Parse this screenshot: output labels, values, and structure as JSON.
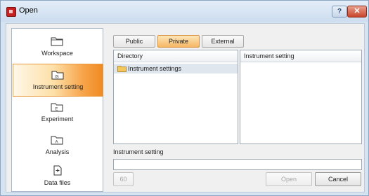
{
  "window": {
    "title": "Open",
    "help_label": "?",
    "close_label": "✕"
  },
  "sidebar": {
    "items": [
      {
        "label": "Workspace",
        "icon": "folder-icon"
      },
      {
        "label": "Instrument setting",
        "icon": "folder-is-icon",
        "selected": true
      },
      {
        "label": "Experiment",
        "icon": "folder-e-icon"
      },
      {
        "label": "Analysis",
        "icon": "folder-a-icon"
      },
      {
        "label": "Data files",
        "icon": "document-plus-icon"
      }
    ]
  },
  "tabs": [
    {
      "label": "Public"
    },
    {
      "label": "Private",
      "selected": true
    },
    {
      "label": "External"
    }
  ],
  "directory": {
    "header": "Directory",
    "items": [
      "Instrument settings"
    ]
  },
  "instrument_list": {
    "header": "Instrument setting"
  },
  "name_field": {
    "label": "Instrument setting",
    "value": ""
  },
  "buttons": {
    "small_label": "60",
    "open_label": "Open",
    "cancel_label": "Cancel"
  },
  "colors": {
    "accent": "#f08a22",
    "title_bar": "#d6e3f1",
    "close": "#c9442b"
  }
}
